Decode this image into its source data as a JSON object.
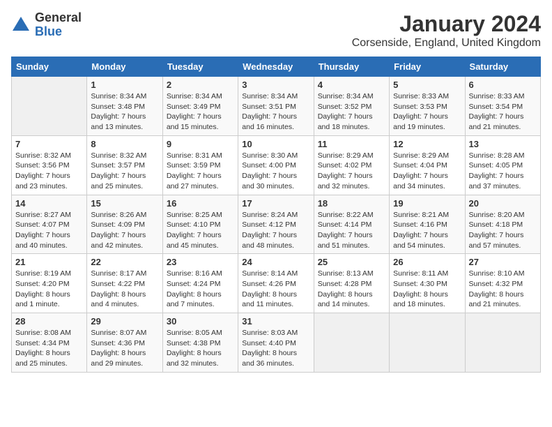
{
  "logo": {
    "general": "General",
    "blue": "Blue"
  },
  "title": "January 2024",
  "location": "Corsenside, England, United Kingdom",
  "weekdays": [
    "Sunday",
    "Monday",
    "Tuesday",
    "Wednesday",
    "Thursday",
    "Friday",
    "Saturday"
  ],
  "weeks": [
    [
      {
        "day": "",
        "sunrise": "",
        "sunset": "",
        "daylight": ""
      },
      {
        "day": "1",
        "sunrise": "Sunrise: 8:34 AM",
        "sunset": "Sunset: 3:48 PM",
        "daylight": "Daylight: 7 hours and 13 minutes."
      },
      {
        "day": "2",
        "sunrise": "Sunrise: 8:34 AM",
        "sunset": "Sunset: 3:49 PM",
        "daylight": "Daylight: 7 hours and 15 minutes."
      },
      {
        "day": "3",
        "sunrise": "Sunrise: 8:34 AM",
        "sunset": "Sunset: 3:51 PM",
        "daylight": "Daylight: 7 hours and 16 minutes."
      },
      {
        "day": "4",
        "sunrise": "Sunrise: 8:34 AM",
        "sunset": "Sunset: 3:52 PM",
        "daylight": "Daylight: 7 hours and 18 minutes."
      },
      {
        "day": "5",
        "sunrise": "Sunrise: 8:33 AM",
        "sunset": "Sunset: 3:53 PM",
        "daylight": "Daylight: 7 hours and 19 minutes."
      },
      {
        "day": "6",
        "sunrise": "Sunrise: 8:33 AM",
        "sunset": "Sunset: 3:54 PM",
        "daylight": "Daylight: 7 hours and 21 minutes."
      }
    ],
    [
      {
        "day": "7",
        "sunrise": "Sunrise: 8:32 AM",
        "sunset": "Sunset: 3:56 PM",
        "daylight": "Daylight: 7 hours and 23 minutes."
      },
      {
        "day": "8",
        "sunrise": "Sunrise: 8:32 AM",
        "sunset": "Sunset: 3:57 PM",
        "daylight": "Daylight: 7 hours and 25 minutes."
      },
      {
        "day": "9",
        "sunrise": "Sunrise: 8:31 AM",
        "sunset": "Sunset: 3:59 PM",
        "daylight": "Daylight: 7 hours and 27 minutes."
      },
      {
        "day": "10",
        "sunrise": "Sunrise: 8:30 AM",
        "sunset": "Sunset: 4:00 PM",
        "daylight": "Daylight: 7 hours and 30 minutes."
      },
      {
        "day": "11",
        "sunrise": "Sunrise: 8:29 AM",
        "sunset": "Sunset: 4:02 PM",
        "daylight": "Daylight: 7 hours and 32 minutes."
      },
      {
        "day": "12",
        "sunrise": "Sunrise: 8:29 AM",
        "sunset": "Sunset: 4:04 PM",
        "daylight": "Daylight: 7 hours and 34 minutes."
      },
      {
        "day": "13",
        "sunrise": "Sunrise: 8:28 AM",
        "sunset": "Sunset: 4:05 PM",
        "daylight": "Daylight: 7 hours and 37 minutes."
      }
    ],
    [
      {
        "day": "14",
        "sunrise": "Sunrise: 8:27 AM",
        "sunset": "Sunset: 4:07 PM",
        "daylight": "Daylight: 7 hours and 40 minutes."
      },
      {
        "day": "15",
        "sunrise": "Sunrise: 8:26 AM",
        "sunset": "Sunset: 4:09 PM",
        "daylight": "Daylight: 7 hours and 42 minutes."
      },
      {
        "day": "16",
        "sunrise": "Sunrise: 8:25 AM",
        "sunset": "Sunset: 4:10 PM",
        "daylight": "Daylight: 7 hours and 45 minutes."
      },
      {
        "day": "17",
        "sunrise": "Sunrise: 8:24 AM",
        "sunset": "Sunset: 4:12 PM",
        "daylight": "Daylight: 7 hours and 48 minutes."
      },
      {
        "day": "18",
        "sunrise": "Sunrise: 8:22 AM",
        "sunset": "Sunset: 4:14 PM",
        "daylight": "Daylight: 7 hours and 51 minutes."
      },
      {
        "day": "19",
        "sunrise": "Sunrise: 8:21 AM",
        "sunset": "Sunset: 4:16 PM",
        "daylight": "Daylight: 7 hours and 54 minutes."
      },
      {
        "day": "20",
        "sunrise": "Sunrise: 8:20 AM",
        "sunset": "Sunset: 4:18 PM",
        "daylight": "Daylight: 7 hours and 57 minutes."
      }
    ],
    [
      {
        "day": "21",
        "sunrise": "Sunrise: 8:19 AM",
        "sunset": "Sunset: 4:20 PM",
        "daylight": "Daylight: 8 hours and 1 minute."
      },
      {
        "day": "22",
        "sunrise": "Sunrise: 8:17 AM",
        "sunset": "Sunset: 4:22 PM",
        "daylight": "Daylight: 8 hours and 4 minutes."
      },
      {
        "day": "23",
        "sunrise": "Sunrise: 8:16 AM",
        "sunset": "Sunset: 4:24 PM",
        "daylight": "Daylight: 8 hours and 7 minutes."
      },
      {
        "day": "24",
        "sunrise": "Sunrise: 8:14 AM",
        "sunset": "Sunset: 4:26 PM",
        "daylight": "Daylight: 8 hours and 11 minutes."
      },
      {
        "day": "25",
        "sunrise": "Sunrise: 8:13 AM",
        "sunset": "Sunset: 4:28 PM",
        "daylight": "Daylight: 8 hours and 14 minutes."
      },
      {
        "day": "26",
        "sunrise": "Sunrise: 8:11 AM",
        "sunset": "Sunset: 4:30 PM",
        "daylight": "Daylight: 8 hours and 18 minutes."
      },
      {
        "day": "27",
        "sunrise": "Sunrise: 8:10 AM",
        "sunset": "Sunset: 4:32 PM",
        "daylight": "Daylight: 8 hours and 21 minutes."
      }
    ],
    [
      {
        "day": "28",
        "sunrise": "Sunrise: 8:08 AM",
        "sunset": "Sunset: 4:34 PM",
        "daylight": "Daylight: 8 hours and 25 minutes."
      },
      {
        "day": "29",
        "sunrise": "Sunrise: 8:07 AM",
        "sunset": "Sunset: 4:36 PM",
        "daylight": "Daylight: 8 hours and 29 minutes."
      },
      {
        "day": "30",
        "sunrise": "Sunrise: 8:05 AM",
        "sunset": "Sunset: 4:38 PM",
        "daylight": "Daylight: 8 hours and 32 minutes."
      },
      {
        "day": "31",
        "sunrise": "Sunrise: 8:03 AM",
        "sunset": "Sunset: 4:40 PM",
        "daylight": "Daylight: 8 hours and 36 minutes."
      },
      {
        "day": "",
        "sunrise": "",
        "sunset": "",
        "daylight": ""
      },
      {
        "day": "",
        "sunrise": "",
        "sunset": "",
        "daylight": ""
      },
      {
        "day": "",
        "sunrise": "",
        "sunset": "",
        "daylight": ""
      }
    ]
  ]
}
